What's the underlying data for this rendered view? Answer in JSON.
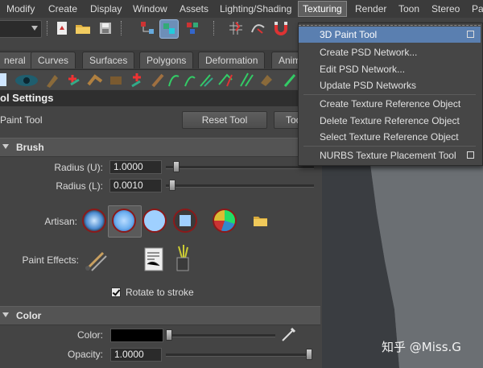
{
  "menubar": {
    "items": [
      "Modify",
      "Create",
      "Display",
      "Window",
      "Assets",
      "Lighting/Shading",
      "Texturing",
      "Render",
      "Toon",
      "Stereo",
      "Pa"
    ],
    "active_index": 6
  },
  "shelf": {
    "tabs": [
      "neral",
      "Curves",
      "Surfaces",
      "Polygons",
      "Deformation",
      "Anim"
    ]
  },
  "tool_settings": {
    "title": "ol Settings",
    "tool_name": "Paint Tool",
    "reset_label": "Reset Tool",
    "help_label": "Too",
    "brush": {
      "header": "Brush",
      "radius_u_label": "Radius (U):",
      "radius_u_value": "1.0000",
      "radius_u_level": 0.05,
      "radius_l_label": "Radius (L):",
      "radius_l_value": "0.0010",
      "radius_l_level": 0.02,
      "artisan_label": "Artisan:",
      "paint_effects_label": "Paint Effects:",
      "rotate_label": "Rotate to stroke",
      "rotate_checked": true
    },
    "color": {
      "header": "Color",
      "color_label": "Color:",
      "color_value": "#000000",
      "color_level": 0.0,
      "opacity_label": "Opacity:",
      "opacity_value": "1.0000",
      "opacity_level": 1.0
    }
  },
  "texturing_menu": {
    "items": [
      {
        "label": "3D Paint Tool",
        "selected": true,
        "option_box": true
      },
      {
        "label": "Create PSD Network...",
        "selected": false,
        "option_box": false
      },
      {
        "label": "Edit PSD Network...",
        "selected": false,
        "option_box": false
      },
      {
        "label": "Update PSD Networks",
        "selected": false,
        "option_box": false
      },
      {
        "label": "Create Texture Reference Object",
        "selected": false,
        "option_box": false
      },
      {
        "label": "Delete Texture Reference Object",
        "selected": false,
        "option_box": false
      },
      {
        "label": "Select Texture Reference Object",
        "selected": false,
        "option_box": false
      },
      {
        "label": "NURBS Texture Placement Tool",
        "selected": false,
        "option_box": true
      }
    ]
  },
  "watermark": "知乎 @Miss.G",
  "colors": {
    "menu_highlight": "#5a7fb0",
    "artisan_ring": "#8a1a1a",
    "panel_bg": "#444444"
  },
  "icons": [
    "3d-paint-icon",
    "pencil-icon",
    "folder-icon",
    "save-icon",
    "select-icon",
    "magnet-icon",
    "paint-effects-icon",
    "brush-icon",
    "globe-icon"
  ]
}
